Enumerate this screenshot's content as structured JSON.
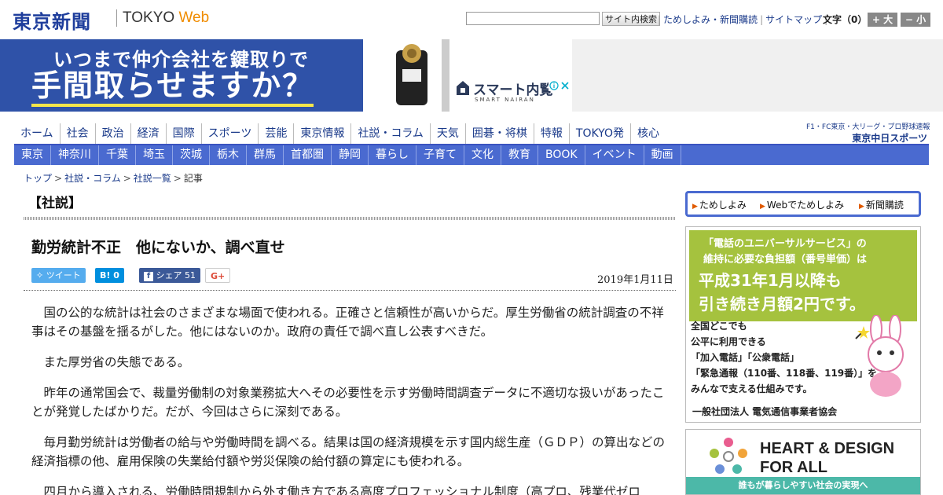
{
  "header": {
    "logo_ja": "東京新聞",
    "logo_en_a": "TOKYO",
    "logo_en_b": "Web",
    "search_placeholder": "",
    "search_button": "サイト内検索",
    "links": [
      "ためしよみ・新聞購読",
      "サイトマップ"
    ],
    "font_label": "文字（0）",
    "font_bigger": "+ 大",
    "font_smaller": "− 小"
  },
  "ad_banner": {
    "line1": "いつまで仲介会社を鍵取りで",
    "line2": "手間取らせますか？",
    "brand": "スマート内覧",
    "brand_sub": "SMART NAIRAN"
  },
  "nav_primary": [
    "ホーム",
    "社会",
    "政治",
    "経済",
    "国際",
    "スポーツ",
    "芸能",
    "東京情報",
    "社説・コラム",
    "天気",
    "囲碁・将棋",
    "特報",
    "TOKYO発",
    "核心"
  ],
  "sports_link": {
    "line1": "F1・FC東京・大リーグ・プロ野球速報",
    "line2": "東京中日スポーツ"
  },
  "nav_secondary": [
    "東京",
    "神奈川",
    "千葉",
    "埼玉",
    "茨城",
    "栃木",
    "群馬",
    "首都圏",
    "静岡",
    "暮らし",
    "子育て",
    "文化",
    "教育",
    "BOOK",
    "イベント",
    "動画"
  ],
  "breadcrumb": [
    "トップ",
    "社説・コラム",
    "社説一覧",
    "記事"
  ],
  "article": {
    "section": "【社説】",
    "headline": "勤労統計不正　他にないか、調べ直せ",
    "date": "2019年1月11日",
    "share": {
      "tweet": "ツイート",
      "hatena": "B! 0",
      "facebook": "シェア 51",
      "gplus": "G+"
    },
    "paragraphs": [
      "国の公的な統計は社会のさまざまな場面で使われる。正確さと信頼性が高いからだ。厚生労働省の統計調査の不祥事はその基盤を揺るがした。他にはないのか。政府の責任で調べ直し公表すべきだ。",
      "また厚労省の失態である。",
      "昨年の通常国会で、裁量労働制の対象業務拡大へその必要性を示す労働時間調査データに不適切な扱いがあったことが発覚したばかりだ。だが、今回はさらに深刻である。",
      "毎月勤労統計は労働者の給与や労働時間を調べる。結果は国の経済規模を示す国内総生産（ＧＤＰ）の算出などの経済指標の他、雇用保険の失業給付額や労災保険の給付額の算定にも使われる。",
      "四月から導入される、労働時間規制から外す働き方である高度プロフェッショナル制度（高プロ、残業代ゼロ"
    ]
  },
  "sidebar": {
    "tabs": [
      "ためしよみ",
      "Webでためしよみ",
      "新聞購読"
    ],
    "ad2": {
      "line1": "「電話のユニバーサルサービス」の",
      "line2": "維持に必要な負担額（番号単価）は",
      "big1": "平成31年1月以降も",
      "big2": "引き続き月額2円です。",
      "body": [
        "全国どこでも",
        "公平に利用できる",
        "「加入電話」「公衆電話」",
        "「緊急通報（110番、118番、119番）」を",
        "みんなで支える仕組みです。"
      ],
      "foot": "一般社団法人 電気通信事業者協会"
    },
    "ad3": {
      "title1": "HEART & DESIGN",
      "title2": "FOR ALL",
      "bar": "誰もが暮らしやすい社会の実現へ"
    }
  },
  "colors": {
    "brand_blue": "#1f3e9c",
    "nav_blue": "#4a6ad0",
    "tweet": "#55acee",
    "hatena": "#008fde",
    "facebook": "#3b5998",
    "ad_green": "#a5c23e"
  }
}
